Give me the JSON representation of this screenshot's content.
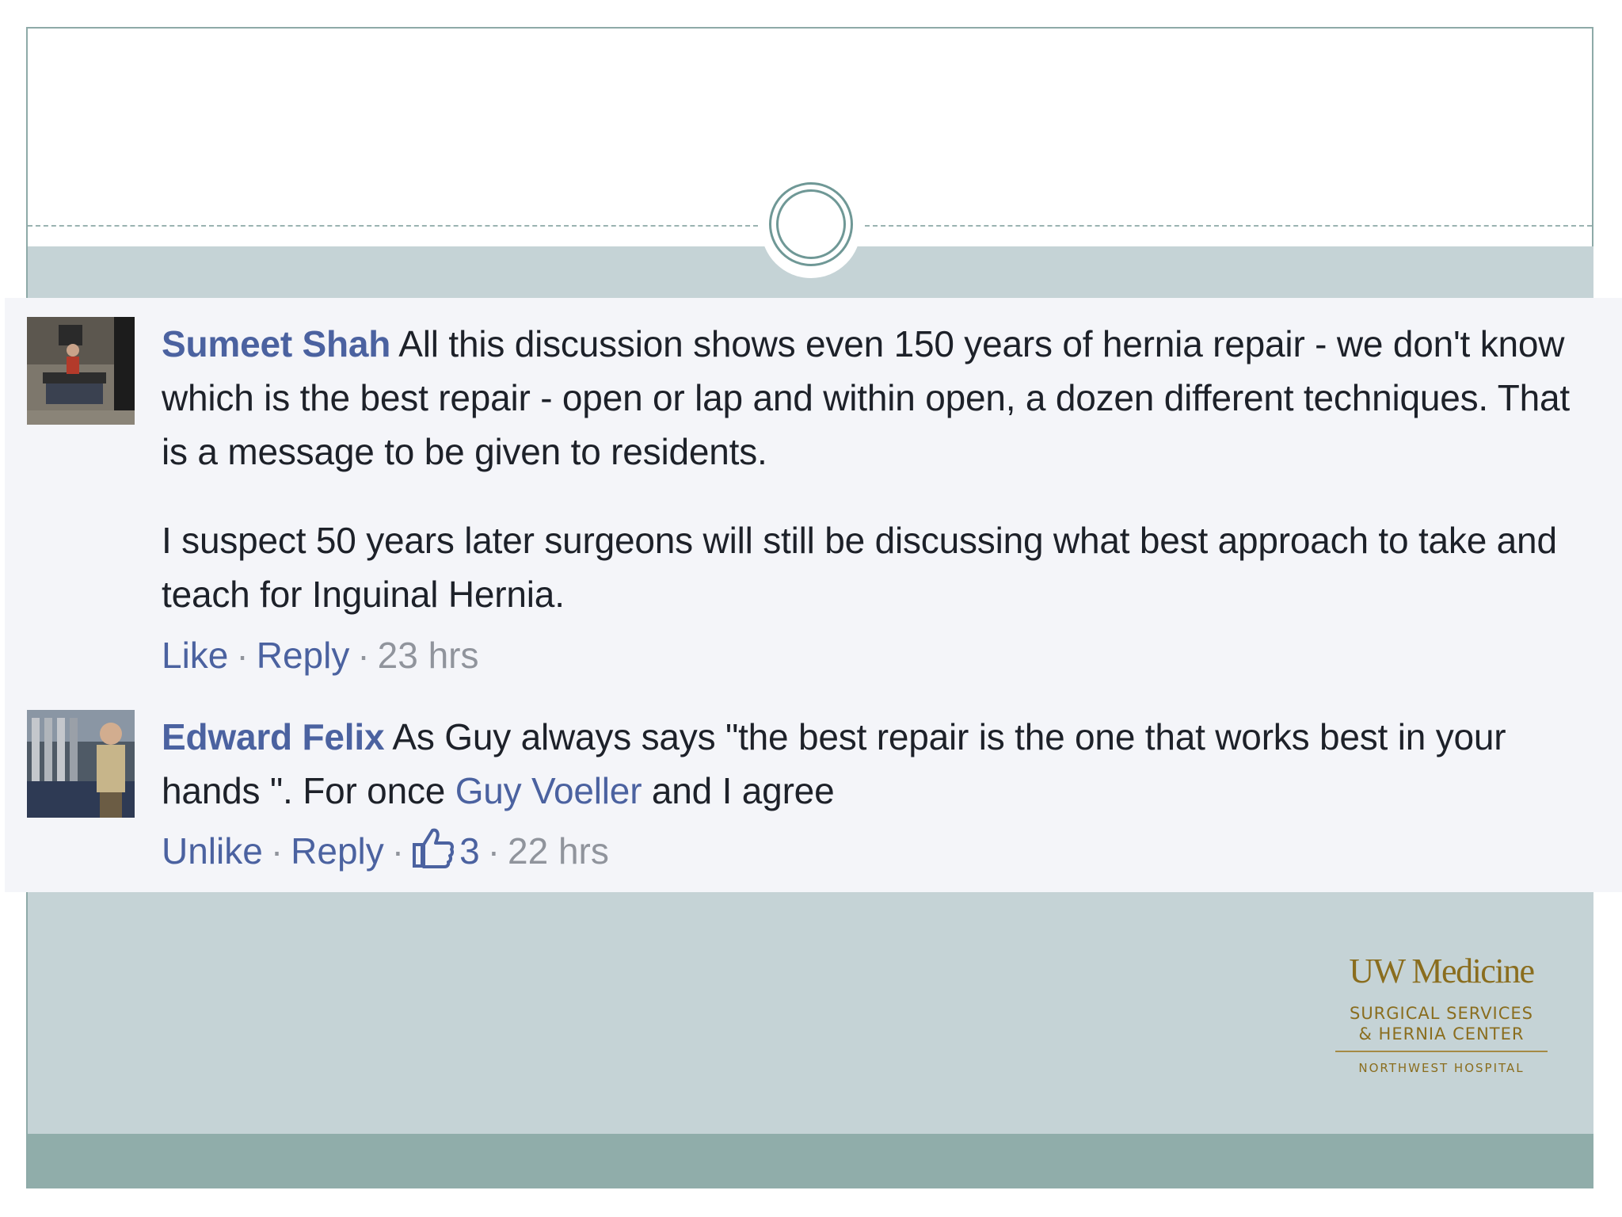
{
  "comments": [
    {
      "author": "Sumeet Shah",
      "text": " All this discussion shows even 150 years of hernia repair - we don't know which is the best repair - open or lap and within open, a dozen different techniques. That is a message to be given to residents.",
      "text2": "I suspect 50 years later surgeons will still be discussing what best approach to take and teach for Inguinal Hernia.",
      "actions": {
        "like": "Like",
        "reply": "Reply",
        "time": "23 hrs"
      }
    },
    {
      "author": "Edward Felix",
      "text_before": " As Guy always says \"the best repair is the one that works best in your hands \". For once ",
      "mention": "Guy Voeller",
      "text_after": " and I agree",
      "actions": {
        "like": "Unlike",
        "reply": "Reply",
        "likes_count": "3",
        "time": "22 hrs"
      }
    }
  ],
  "separator": "·",
  "logo": {
    "main": "UW Medicine",
    "line1": "SURGICAL SERVICES",
    "line2": "& HERNIA CENTER",
    "footer": "NORTHWEST HOSPITAL"
  },
  "colors": {
    "link": "#4b62a0",
    "band": "#c5d3d6",
    "footer_band": "#90adaa",
    "logo_gold": "#8a6d1e"
  },
  "icons": {
    "like": "thumbs-up-icon"
  }
}
